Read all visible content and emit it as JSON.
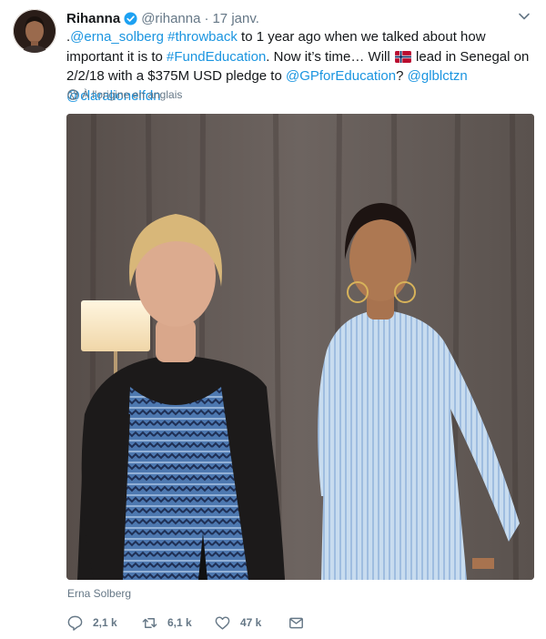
{
  "tweet": {
    "author_name": "Rihanna",
    "handle": "@rihanna",
    "separator": "·",
    "date": "17 janv.",
    "text_parts": [
      {
        "text": ".",
        "type": "plain"
      },
      {
        "text": "@erna_solberg",
        "type": "mention"
      },
      {
        "text": " ",
        "type": "plain"
      },
      {
        "text": "#throwback",
        "type": "hashtag"
      },
      {
        "text": " to 1 year ago when we talked about how important it is to ",
        "type": "plain"
      },
      {
        "text": "#FundEducation",
        "type": "hashtag"
      },
      {
        "text": ". Now it’s time… Will ",
        "type": "plain"
      },
      {
        "text": " lead in Senegal on 2/2/18 with a $375M USD pledge to ",
        "type": "plain"
      },
      {
        "text": "@GPforEducation",
        "type": "mention"
      },
      {
        "text": "? ",
        "type": "plain"
      },
      {
        "text": "@glblctzn",
        "type": "mention"
      },
      {
        "text": " ",
        "type": "plain"
      },
      {
        "text": "@claralionelfdn",
        "type": "mention"
      }
    ],
    "translate_label": "À l'origine en anglais",
    "photo_tag": "Erna Solberg",
    "counts": {
      "replies": "2,1 k",
      "retweets": "6,1 k",
      "likes": "47 k"
    },
    "icons": {
      "verified": "verified-badge-icon",
      "caret": "chevron-down-icon",
      "translate": "globe-icon",
      "flag": "norway-flag-icon",
      "reply": "reply-icon",
      "retweet": "retweet-icon",
      "like": "heart-icon",
      "dm": "envelope-icon"
    },
    "colors": {
      "link": "#1b95e0",
      "muted": "#657786",
      "verified": "#1da1f2"
    }
  }
}
